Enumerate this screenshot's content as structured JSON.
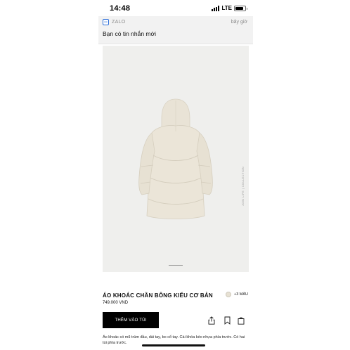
{
  "status_bar": {
    "time": "14:48",
    "network": "LTE"
  },
  "notification": {
    "app_name": "ZALO",
    "time": "bây giờ",
    "message": "Bạn có tin nhắn mới"
  },
  "product": {
    "image_alt": "cream puffer jacket, back view",
    "collection_label": "JOIN LIFE | COLLECTION",
    "title": "ÁO KHOÁC CHẦN BÔNG KIỂU CƠ BẢN",
    "price": "749.000 VND",
    "swatch_color": "#e7e1d3",
    "more_colors": "+3 MÀU",
    "add_to_cart_label": "THÊM VÀO TÚI",
    "description": "Áo khoác có mũ trùm đầu, dài tay, bo cổ tay. Cài khóa kéo nhựa phía trước. Có hai túi phía trước."
  },
  "icons": {
    "share": "share-icon",
    "favorite": "heart-icon",
    "bag": "bag-icon"
  },
  "colors": {
    "background": "#efefed",
    "button": "#000000",
    "jacket": "#ebe5d8"
  }
}
